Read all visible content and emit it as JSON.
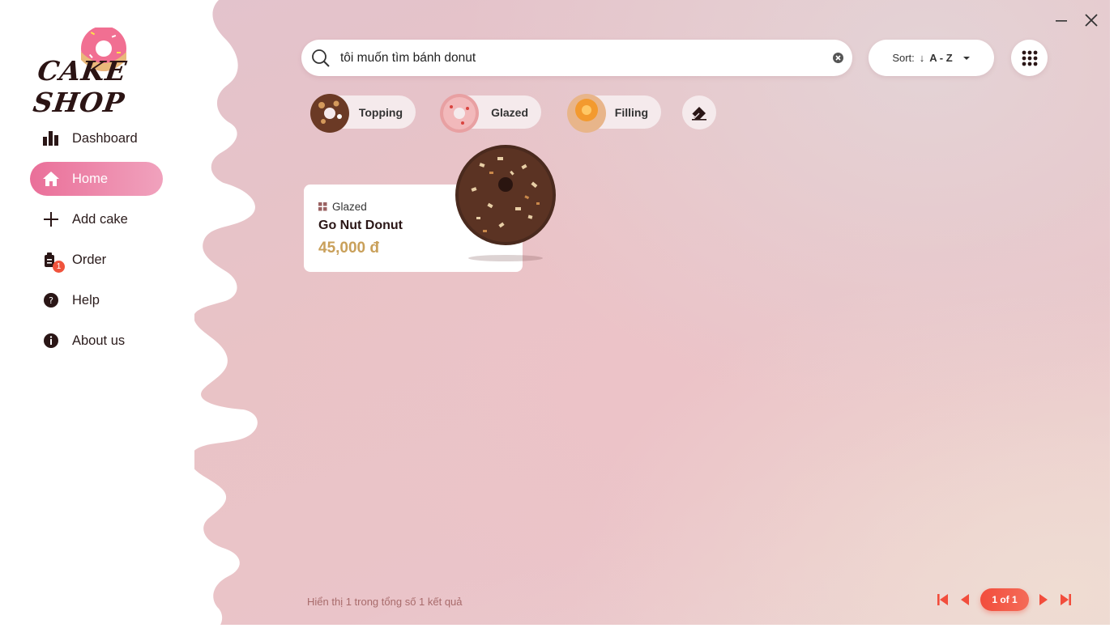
{
  "app": {
    "logo_text": "CAKE SHOP",
    "colors": {
      "accent": "#ea6f99",
      "price": "#c9a05a",
      "badge": "#f0533c",
      "pager": "#f24d3c"
    }
  },
  "window": {
    "minimize_icon": "–",
    "close_icon": "✕"
  },
  "sidebar": {
    "items": [
      {
        "label": "Dashboard",
        "icon": "bar-chart-icon",
        "active": false
      },
      {
        "label": "Home",
        "icon": "home-icon",
        "active": true
      },
      {
        "label": "Add cake",
        "icon": "plus-icon",
        "active": false
      },
      {
        "label": "Order",
        "icon": "order-icon",
        "active": false,
        "badge": "1"
      },
      {
        "label": "Help",
        "icon": "help-icon",
        "active": false
      },
      {
        "label": "About us",
        "icon": "info-icon",
        "active": false
      }
    ]
  },
  "search": {
    "value": "tôi muốn tìm bánh donut",
    "placeholder": ""
  },
  "sort": {
    "prefix": "Sort:",
    "arrow": "↓",
    "value": "A - Z"
  },
  "filters": [
    {
      "label": "Topping"
    },
    {
      "label": "Glazed"
    },
    {
      "label": "Filling"
    }
  ],
  "products": [
    {
      "category": "Glazed",
      "name": "Go Nut Donut",
      "price": "45,000 đ"
    }
  ],
  "footer": {
    "result_text": "Hiển thị 1 trong tổng số 1 kết quả",
    "page_label": "1 of 1"
  }
}
